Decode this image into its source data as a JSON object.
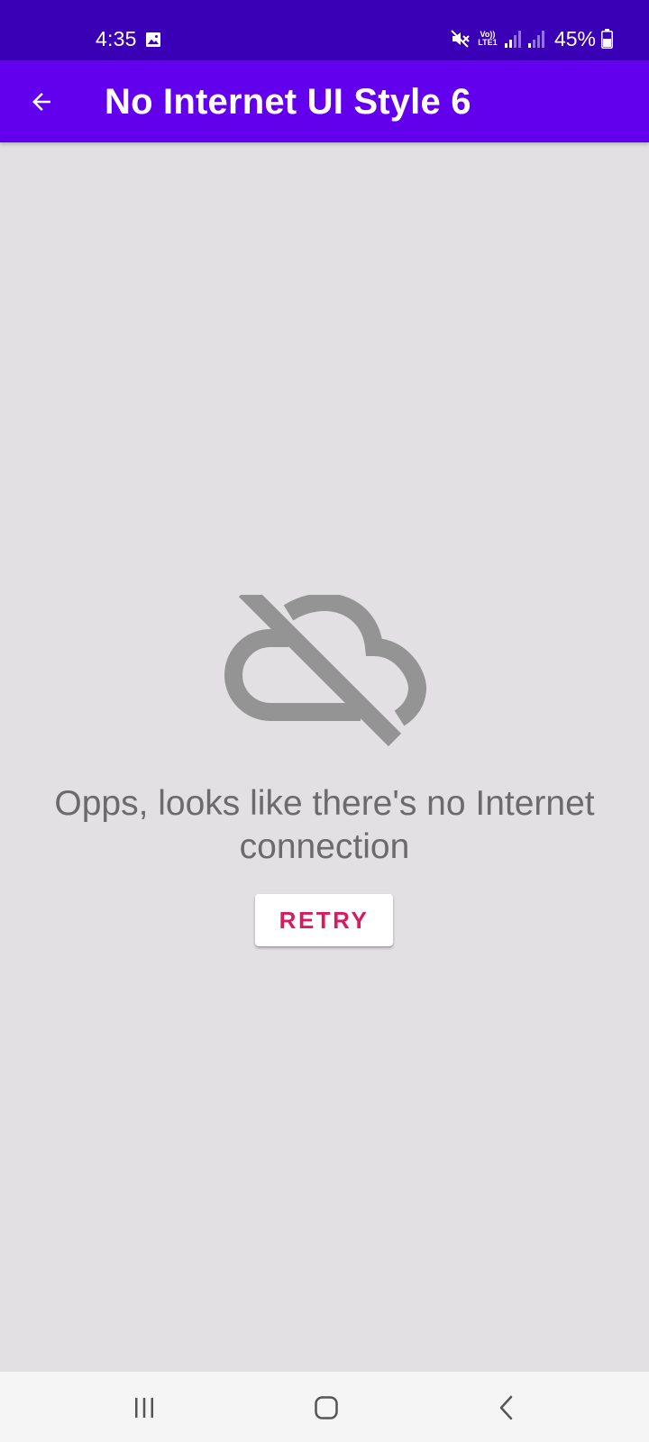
{
  "status_bar": {
    "time": "4:35",
    "volte_line1": "Vo))",
    "volte_line2": "LTE1",
    "battery": "45%",
    "icons": [
      "gallery-icon",
      "mute-icon",
      "signal-icon",
      "signal-icon",
      "battery-icon"
    ]
  },
  "app_bar": {
    "title": "No Internet UI Style 6",
    "back_icon": "arrow-back-icon"
  },
  "content": {
    "icon": "cloud-off-icon",
    "message": "Opps, looks like there's no Internet connection",
    "retry_label": "RETRY"
  },
  "nav_bar": {
    "icons": [
      "recent-apps-icon",
      "home-icon",
      "back-icon"
    ]
  },
  "colors": {
    "status_bar": "#3a00b5",
    "app_bar": "#6200ee",
    "background": "#e2e0e2",
    "message_text": "#6b6b6b",
    "icon_gray": "#949494",
    "retry_text": "#d81b60"
  }
}
